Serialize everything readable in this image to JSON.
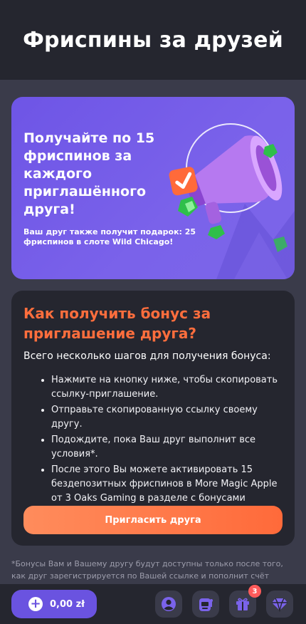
{
  "header": {
    "title": "Фриспины за друзей"
  },
  "promo": {
    "title": "Получайте по 15 фриспинов за каждого приглашённого друга!",
    "subtitle": "Ваш друг также получит подарок: 25 фриспинов в слоте Wild Chicago!"
  },
  "steps_card": {
    "heading": "Как получить бонус за приглашение друга?",
    "lead": "Всего несколько шагов для получения бонуса:",
    "steps": [
      "Нажмите на кнопку ниже, чтобы скопировать ссылку-приглашение.",
      "Отправьте скопированную ссылку своему другу.",
      "Подождите, пока Ваш друг выполнит все условия*.",
      "После этого Вы можете активировать 15 бездепозитных фриспинов в More Magic Apple от 3 Oaks Gaming в разделе с бонусами"
    ],
    "invite_button": "Пригласить друга"
  },
  "footnote": "*Бонусы Вам и Вашему другу будут доступны только после того, как друг зарегистрируется по Вашей ссылке и пополнит счёт суммарно от",
  "bottom_bar": {
    "balance": "0,00 zł",
    "gifts_badge": "3",
    "icons": [
      "plus-icon",
      "profile-icon",
      "slot-machine-icon",
      "gift-icon",
      "diamond-icon"
    ]
  },
  "colors": {
    "accent": "#ff6e3d",
    "promo_bg": "#6e55e6",
    "card_bg": "#25262f",
    "page_bg": "#3a3b4a"
  }
}
